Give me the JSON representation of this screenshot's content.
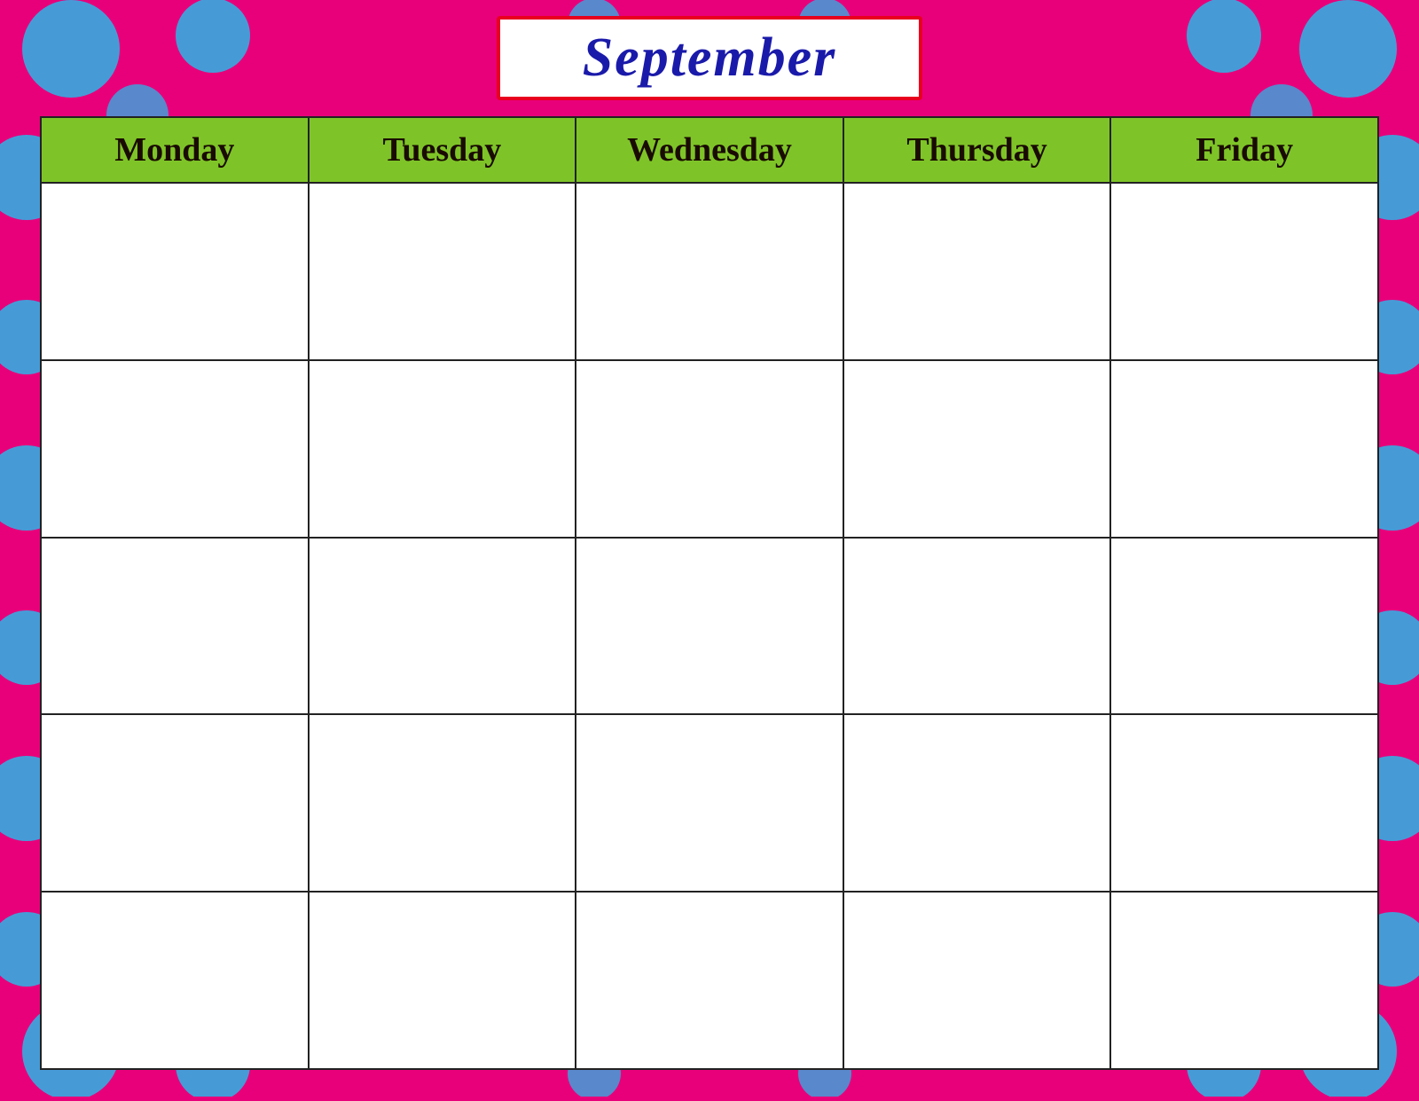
{
  "calendar": {
    "title": "September",
    "days": [
      "Monday",
      "Tuesday",
      "Wednesday",
      "Thursday",
      "Friday"
    ],
    "weeks": 5
  },
  "background": {
    "bg_color": "#e8007a",
    "dot_color": "#29b6e8"
  }
}
